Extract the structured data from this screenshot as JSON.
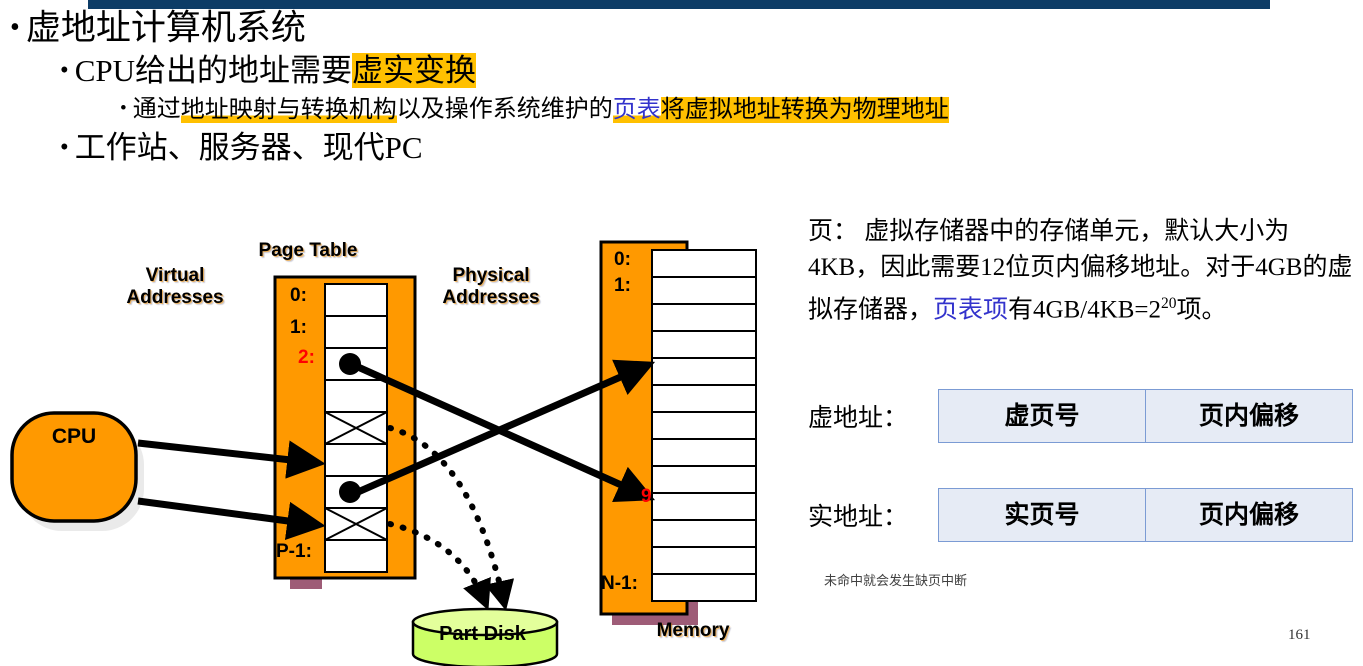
{
  "slide": {
    "page_number": "161",
    "accent_navy": "#0d3c66",
    "highlight_color": "#FFC000",
    "block_orange": "#FF9900",
    "block_shadow_mauve": "#9E5C77",
    "disk_green": "#CCFF66",
    "link_blue": "#3333CC",
    "marker_red": "#FF0000",
    "table_border_blue": "#7B9BD4",
    "table_fill_blue": "#E6EBF5"
  },
  "bullets": {
    "level1": {
      "bullet": "•",
      "text": "虚地址计算机系统"
    },
    "level2a": {
      "bullet": "•",
      "plain": "CPU给出的地址需要",
      "highlighted": "虚实变换"
    },
    "level3": {
      "bullet": "•",
      "part1": "通过",
      "part2_highlight": "地址映射与转换机构",
      "part3": "以及操作系统维护的",
      "part4_blue": "页表",
      "part5_highlight": "将虚拟地址转换为物理地址"
    },
    "level2b": {
      "bullet": "•",
      "text": "工作站、服务器、现代PC"
    }
  },
  "diagram": {
    "labels": {
      "page_table": "Page Table",
      "virtual_addresses_line1": "Virtual",
      "virtual_addresses_line2": "Addresses",
      "physical_addresses_line1": "Physical",
      "physical_addresses_line2": "Addresses",
      "memory": "Memory",
      "cpu": "CPU",
      "part_disk": "Part Disk"
    },
    "page_table": {
      "row_count": 9,
      "row_labels": [
        "0:",
        "1:",
        "2:",
        "",
        "",
        "",
        "",
        "",
        "P-1:"
      ],
      "red_label_index": 2,
      "rows_with_pointer_dot": [
        2,
        6
      ],
      "rows_with_x_mark": [
        4,
        7
      ]
    },
    "memory": {
      "row_count": 13,
      "row_labels": [
        "0:",
        "1:",
        "",
        "",
        "",
        "",
        "",
        "",
        "",
        "",
        "",
        "",
        "N-1:"
      ],
      "red_marker_label": "9",
      "red_marker_row_index": 9
    }
  },
  "right_panel": {
    "paragraph": {
      "seg1": "页： 虚拟存储器中的存储单元，默认大小为4KB，因此需要12位页内偏移地址。对于4GB的虚拟存储器，",
      "seg2_blue": "页表项",
      "seg3": "有4GB/4KB=2",
      "seg3_sup": "20",
      "seg4": "项。"
    },
    "virtual_address": {
      "caption": "虚地址：",
      "fields": [
        "虚页号",
        "页内偏移"
      ]
    },
    "physical_address": {
      "caption": "实地址：",
      "fields": [
        "实页号",
        "页内偏移"
      ]
    },
    "note": "未命中就会发生缺页中断"
  }
}
